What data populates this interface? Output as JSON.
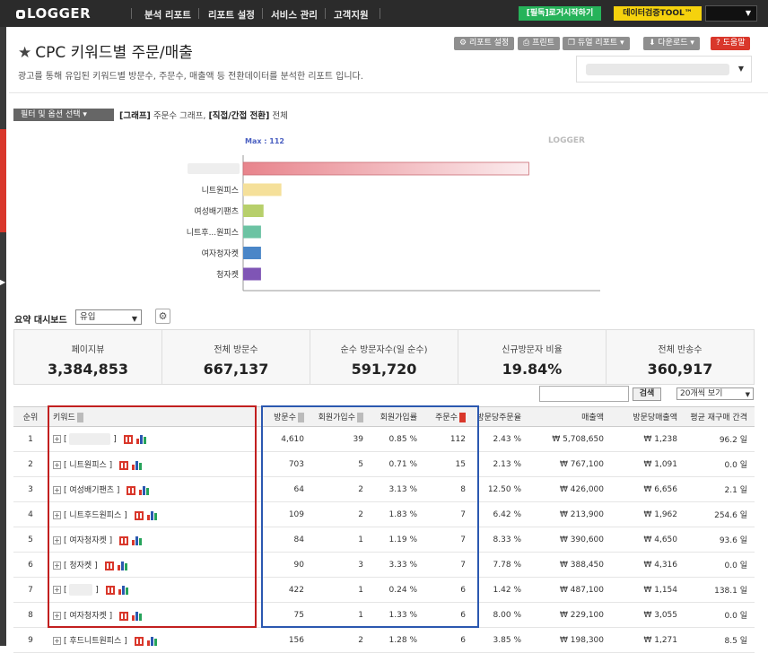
{
  "header": {
    "logo": "LOGGER",
    "nav": [
      "분석 리포트",
      "리포트 설정",
      "서비스 관리",
      "고객지원"
    ],
    "green_button": "[필독]로거시작하기",
    "yellow_button": "데이터검증TOOL™"
  },
  "page": {
    "title": "CPC 키워드별 주문/매출",
    "description": "광고를 통해 유입된 키워드별 방문수, 주문수, 매출액 등 전환데이터를 분석한 리포트 입니다."
  },
  "toolbar": {
    "report_settings": "리포트 설정",
    "print": "프린트",
    "dual_report": "듀얼 리포트",
    "download": "다운로드",
    "help": "도움말"
  },
  "filter": {
    "button": "필터 및 옵션 선택",
    "graph_tag": "[그래프]",
    "graph_value": "주문수 그래프,",
    "conv_tag": "[직접/간접 전환]",
    "conv_value": "전체"
  },
  "chart_meta": {
    "max_label": "Max : 112",
    "logo": "LOGGER"
  },
  "chart_data": {
    "type": "bar",
    "orientation": "horizontal",
    "categories": [
      "",
      "니트원피스",
      "여성배기팬츠",
      "니트후...원피스",
      "여자청자켓",
      "청자켓"
    ],
    "values": [
      112,
      15,
      8,
      7,
      7,
      7
    ],
    "colors": [
      "#e8848c",
      "#f5e09a",
      "#b7cf6b",
      "#6cc3a3",
      "#4a86c8",
      "#7f55b5"
    ],
    "xlim": [
      0,
      140
    ],
    "xticks": [
      0,
      20,
      40,
      60,
      80,
      100,
      120,
      140
    ],
    "title": "",
    "xlabel": "",
    "ylabel": ""
  },
  "summary": {
    "label": "요약 대시보드",
    "select_value": "유입",
    "cards": [
      {
        "label": "페이지뷰",
        "value": "3,384,853"
      },
      {
        "label": "전체 방문수",
        "value": "667,137"
      },
      {
        "label": "순수 방문자수(일 순수)",
        "value": "591,720"
      },
      {
        "label": "신규방문자 비율",
        "value": "19.84%"
      },
      {
        "label": "전체 반송수",
        "value": "360,917"
      }
    ]
  },
  "search": {
    "button": "검색",
    "per_page": "20개씩 보기"
  },
  "table": {
    "headers": [
      "순위",
      "키워드",
      "방문수",
      "회원가입수",
      "회원가입률",
      "주문수",
      "방문당주문율",
      "매출액",
      "방문당매출액",
      "평균 재구매 간격"
    ],
    "rows": [
      {
        "rank": "1",
        "keyword": "",
        "visits": "4,610",
        "signups": "39",
        "signup_rate": "0.85 %",
        "orders": "112",
        "order_rate": "2.43 %",
        "sales": "₩ 5,708,650",
        "sales_per_visit": "₩ 1,238",
        "repurchase": "96.2 일"
      },
      {
        "rank": "2",
        "keyword": "[ 니트원피스 ]",
        "visits": "703",
        "signups": "5",
        "signup_rate": "0.71 %",
        "orders": "15",
        "order_rate": "2.13 %",
        "sales": "₩ 767,100",
        "sales_per_visit": "₩ 1,091",
        "repurchase": "0.0 일"
      },
      {
        "rank": "3",
        "keyword": "[ 여성배기팬츠 ]",
        "visits": "64",
        "signups": "2",
        "signup_rate": "3.13 %",
        "orders": "8",
        "order_rate": "12.50 %",
        "sales": "₩ 426,000",
        "sales_per_visit": "₩ 6,656",
        "repurchase": "2.1 일"
      },
      {
        "rank": "4",
        "keyword": "[ 니트후드원피스 ]",
        "visits": "109",
        "signups": "2",
        "signup_rate": "1.83 %",
        "orders": "7",
        "order_rate": "6.42 %",
        "sales": "₩ 213,900",
        "sales_per_visit": "₩ 1,962",
        "repurchase": "254.6 일"
      },
      {
        "rank": "5",
        "keyword": "[ 여자청자켓 ]",
        "visits": "84",
        "signups": "1",
        "signup_rate": "1.19 %",
        "orders": "7",
        "order_rate": "8.33 %",
        "sales": "₩ 390,600",
        "sales_per_visit": "₩ 4,650",
        "repurchase": "93.6 일"
      },
      {
        "rank": "6",
        "keyword": "[ 청자켓 ]",
        "visits": "90",
        "signups": "3",
        "signup_rate": "3.33 %",
        "orders": "7",
        "order_rate": "7.78 %",
        "sales": "₩ 388,450",
        "sales_per_visit": "₩ 4,316",
        "repurchase": "0.0 일"
      },
      {
        "rank": "7",
        "keyword": "",
        "visits": "422",
        "signups": "1",
        "signup_rate": "0.24 %",
        "orders": "6",
        "order_rate": "1.42 %",
        "sales": "₩ 487,100",
        "sales_per_visit": "₩ 1,154",
        "repurchase": "138.1 일"
      },
      {
        "rank": "8",
        "keyword": "[ 여자청자켓 ]",
        "visits": "75",
        "signups": "1",
        "signup_rate": "1.33 %",
        "orders": "6",
        "order_rate": "8.00 %",
        "sales": "₩ 229,100",
        "sales_per_visit": "₩ 3,055",
        "repurchase": "0.0 일"
      },
      {
        "rank": "9",
        "keyword": "[ 후드니트원피스 ]",
        "visits": "156",
        "signups": "2",
        "signup_rate": "1.28 %",
        "orders": "6",
        "order_rate": "3.85 %",
        "sales": "₩ 198,300",
        "sales_per_visit": "₩ 1,271",
        "repurchase": "8.5 일"
      }
    ]
  }
}
